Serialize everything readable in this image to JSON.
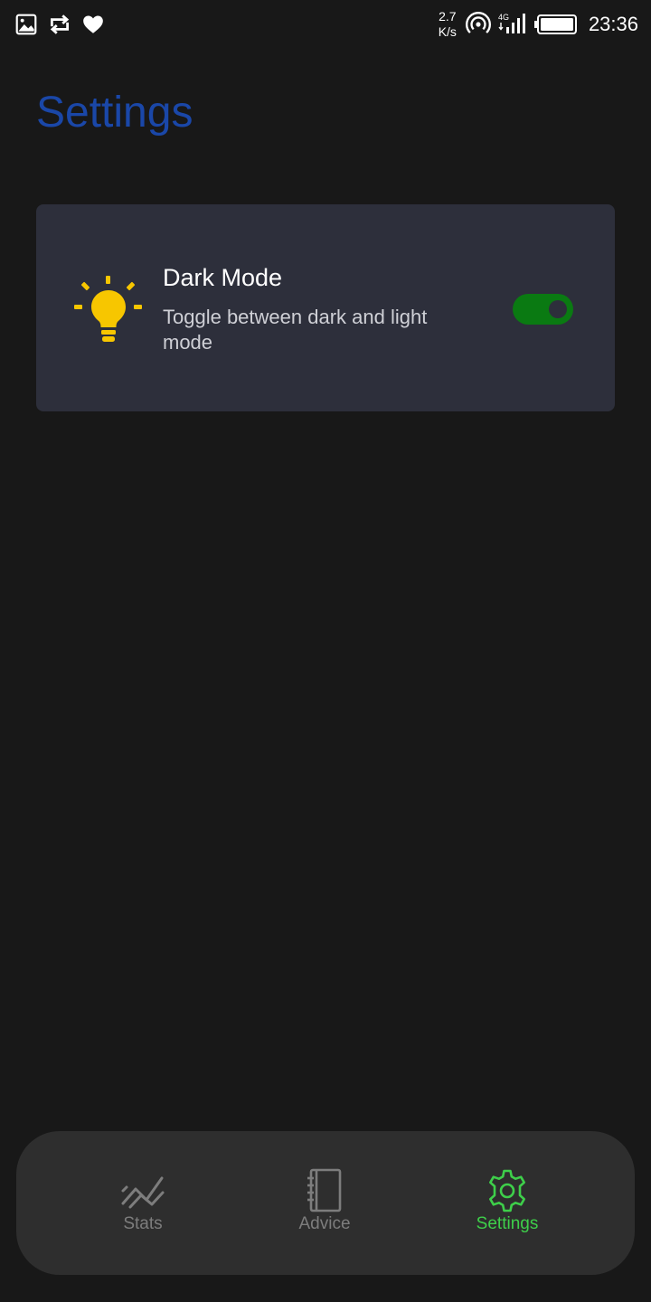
{
  "status_bar": {
    "net_speed_value": "2.7",
    "net_speed_unit": "K/s",
    "network_type": "4G",
    "time": "23:36",
    "left_icons": [
      "image-icon",
      "repeat-icon",
      "heart-icon"
    ],
    "right_icons": [
      "hotspot-icon",
      "signal-icon",
      "battery-icon"
    ]
  },
  "page": {
    "title": "Settings"
  },
  "settings": [
    {
      "icon": "lightbulb-icon",
      "title": "Dark Mode",
      "description": "Toggle between dark and light mode",
      "enabled": true
    }
  ],
  "bottom_nav": {
    "items": [
      {
        "label": "Stats",
        "icon": "trend-chart-icon",
        "active": false
      },
      {
        "label": "Advice",
        "icon": "notebook-icon",
        "active": false
      },
      {
        "label": "Settings",
        "icon": "gear-icon",
        "active": true
      }
    ]
  },
  "colors": {
    "background": "#181818",
    "title": "#1a47a8",
    "card": "#2d2f3b",
    "toggle_on": "#0a7a12",
    "bulb": "#f7c600",
    "nav_active": "#3ecf4a",
    "nav_inactive": "#7d7d7d",
    "nav_background": "#2e2e2e"
  }
}
